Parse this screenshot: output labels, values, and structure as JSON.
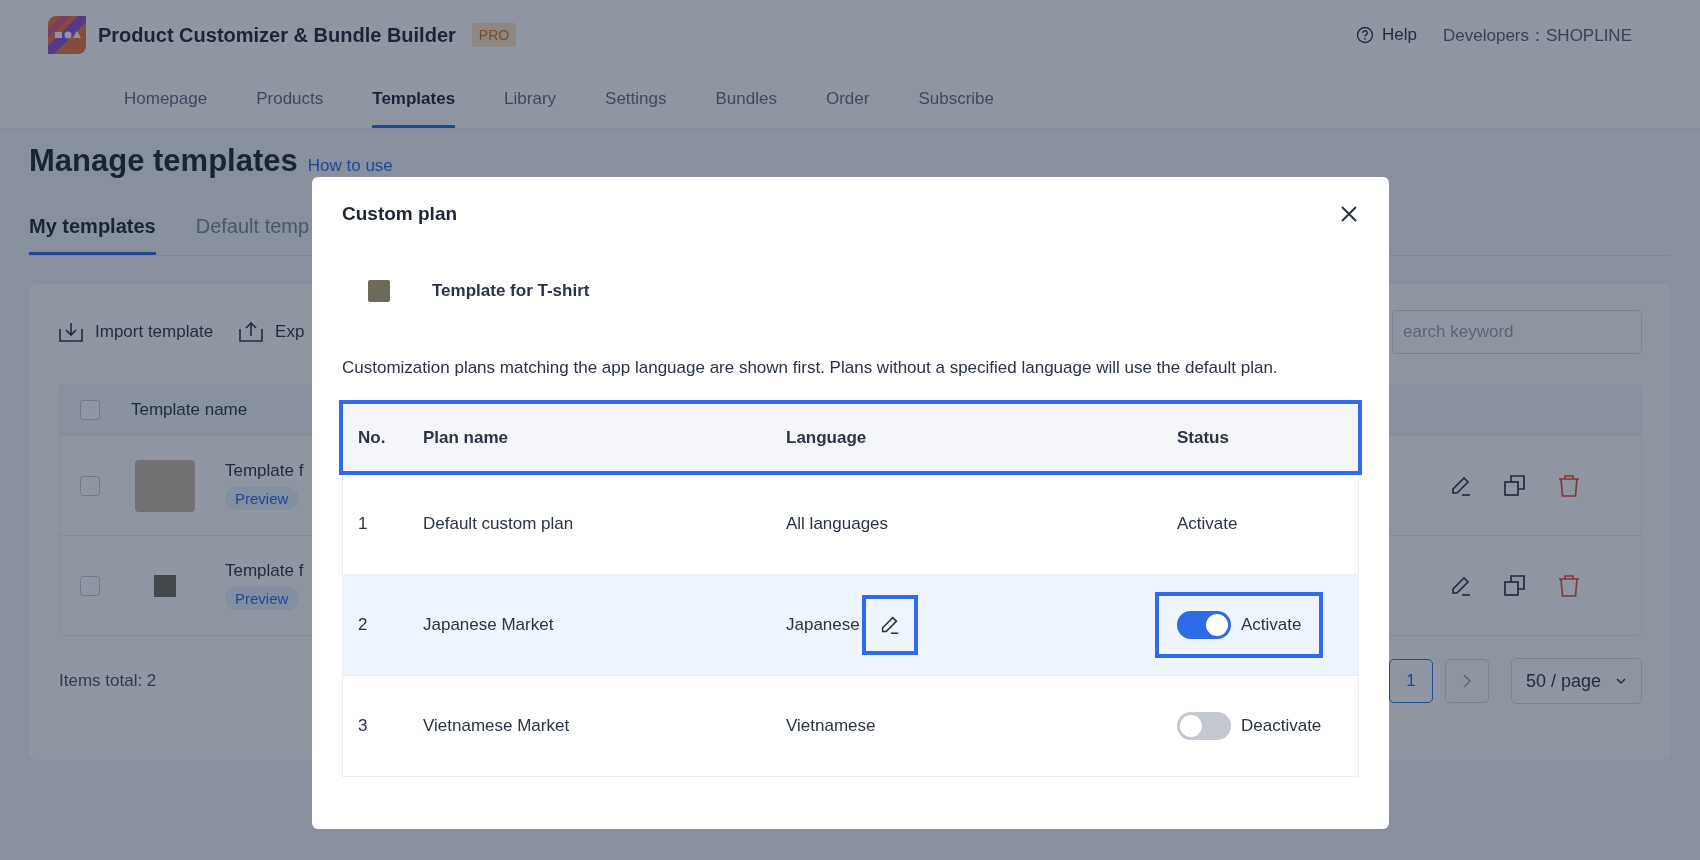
{
  "app": {
    "name": "Product Customizer & Bundle Builder",
    "badge": "PRO",
    "help": "Help",
    "developer": "Developers：SHOPLINE"
  },
  "nav": [
    {
      "label": "Homepage",
      "selected": false
    },
    {
      "label": "Products",
      "selected": false
    },
    {
      "label": "Templates",
      "selected": true
    },
    {
      "label": "Library",
      "selected": false
    },
    {
      "label": "Settings",
      "selected": false
    },
    {
      "label": "Bundles",
      "selected": false
    },
    {
      "label": "Order",
      "selected": false
    },
    {
      "label": "Subscribe",
      "selected": false
    }
  ],
  "page": {
    "title": "Manage templates",
    "help_link": "How to use",
    "tabs": [
      {
        "label": "My templates",
        "selected": true
      },
      {
        "label": "Default temp",
        "selected": false
      }
    ],
    "toolbar": [
      {
        "kind": "import",
        "label": "Import template"
      },
      {
        "kind": "export",
        "label": "Exp"
      }
    ],
    "search": {
      "placeholder": "earch keyword"
    },
    "table": {
      "header_checked": false,
      "column_1": "Template name",
      "rows": [
        {
          "kind": "large",
          "name": "Template f",
          "tag": "Preview",
          "checked": false
        },
        {
          "kind": "small",
          "name": "Template f",
          "tag": "Preview",
          "checked": false
        }
      ]
    },
    "pagination": {
      "total": "Items total: 2",
      "pages": [
        {
          "label": "1",
          "selected": true
        }
      ],
      "page_size": "50 / page"
    }
  },
  "modal": {
    "title": "Custom plan",
    "template_name": "Template for T-shirt",
    "description": "Customization plans matching the app language are shown first. Plans without a specified language will use the default plan.",
    "table": {
      "header_highlighted": true,
      "columns": [
        "No.",
        "Plan name",
        "Language",
        "Status"
      ],
      "rows": [
        {
          "no": "1",
          "name": "Default custom plan",
          "language": "All languages",
          "status": "Activate",
          "kind": "text",
          "editable": false,
          "selected": false
        },
        {
          "no": "2",
          "name": "Japanese Market",
          "language": "Japanese",
          "status": "Activate",
          "kind": "toggle",
          "on": true,
          "editable": true,
          "selected": true,
          "language_highlighted": true,
          "status_highlighted": true
        },
        {
          "no": "3",
          "name": "Vietnamese Market",
          "language": "Vietnamese",
          "status": "Deactivate",
          "kind": "toggle",
          "on": false,
          "editable": false,
          "selected": false,
          "status_highlighted": false
        }
      ]
    }
  }
}
